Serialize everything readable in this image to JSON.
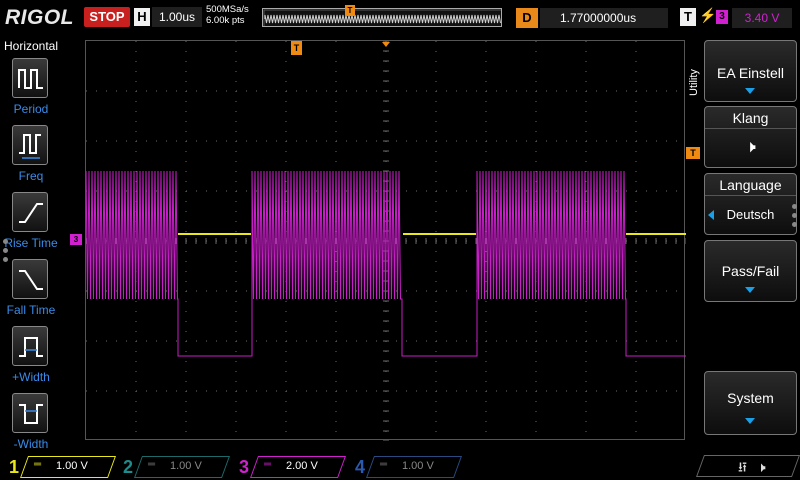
{
  "topbar": {
    "brand": "RIGOL",
    "run_state": "STOP",
    "horizontal_key": "H",
    "horizontal_scale": "1.00us",
    "sample_rate": "500MSa/s",
    "memory_depth": "6.00k pts",
    "trigger_marker": "T",
    "delay_key": "D",
    "delay_value": "1.77000000us",
    "trigger_key": "T",
    "trigger_edge_icon": "rising-edge-icon",
    "trigger_source": "3",
    "trigger_level": "3.40 V"
  },
  "left_menu": {
    "title": "Horizontal",
    "items": [
      {
        "label": "Period",
        "icon": "period-icon"
      },
      {
        "label": "Freq",
        "icon": "frequency-icon"
      },
      {
        "label": "Rise Time",
        "icon": "rise-time-icon"
      },
      {
        "label": "Fall Time",
        "icon": "fall-time-icon"
      },
      {
        "label": "+Width",
        "icon": "positive-width-icon"
      },
      {
        "label": "-Width",
        "icon": "negative-width-icon"
      }
    ]
  },
  "grid": {
    "trigger_position_marker": "T",
    "channel_marker": "3",
    "trigger_level_marker": "T",
    "colors": {
      "ch1": "#e8e81a",
      "ch3": "#d020d0",
      "grid": "#6a6a6a",
      "trigger": "#f08a10"
    }
  },
  "right_menu": {
    "tab_label": "Utility",
    "buttons": [
      {
        "label": "EA Einstell",
        "has_arrow": true
      },
      {
        "label": "Klang",
        "icon": "speaker-mute-icon"
      },
      {
        "label": "Language",
        "value": "Deutsch"
      },
      {
        "label": "Pass/Fail",
        "has_arrow": true
      },
      {
        "label": "System",
        "has_arrow": true
      }
    ]
  },
  "channels": [
    {
      "num": "1",
      "coupling": "═",
      "scale": "1.00 V",
      "color": "#e8e81a",
      "active": true
    },
    {
      "num": "2",
      "coupling": "═",
      "scale": "1.00 V",
      "color": "#1e8c8c",
      "active": false
    },
    {
      "num": "3",
      "coupling": "═",
      "scale": "2.00 V",
      "color": "#d020d0",
      "active": true
    },
    {
      "num": "4",
      "coupling": "═",
      "scale": "1.00 V",
      "color": "#2a5ab0",
      "active": false
    }
  ],
  "bottom_right": {
    "usb_icon": "usb-icon",
    "sound_icon": "speaker-mute-icon"
  }
}
